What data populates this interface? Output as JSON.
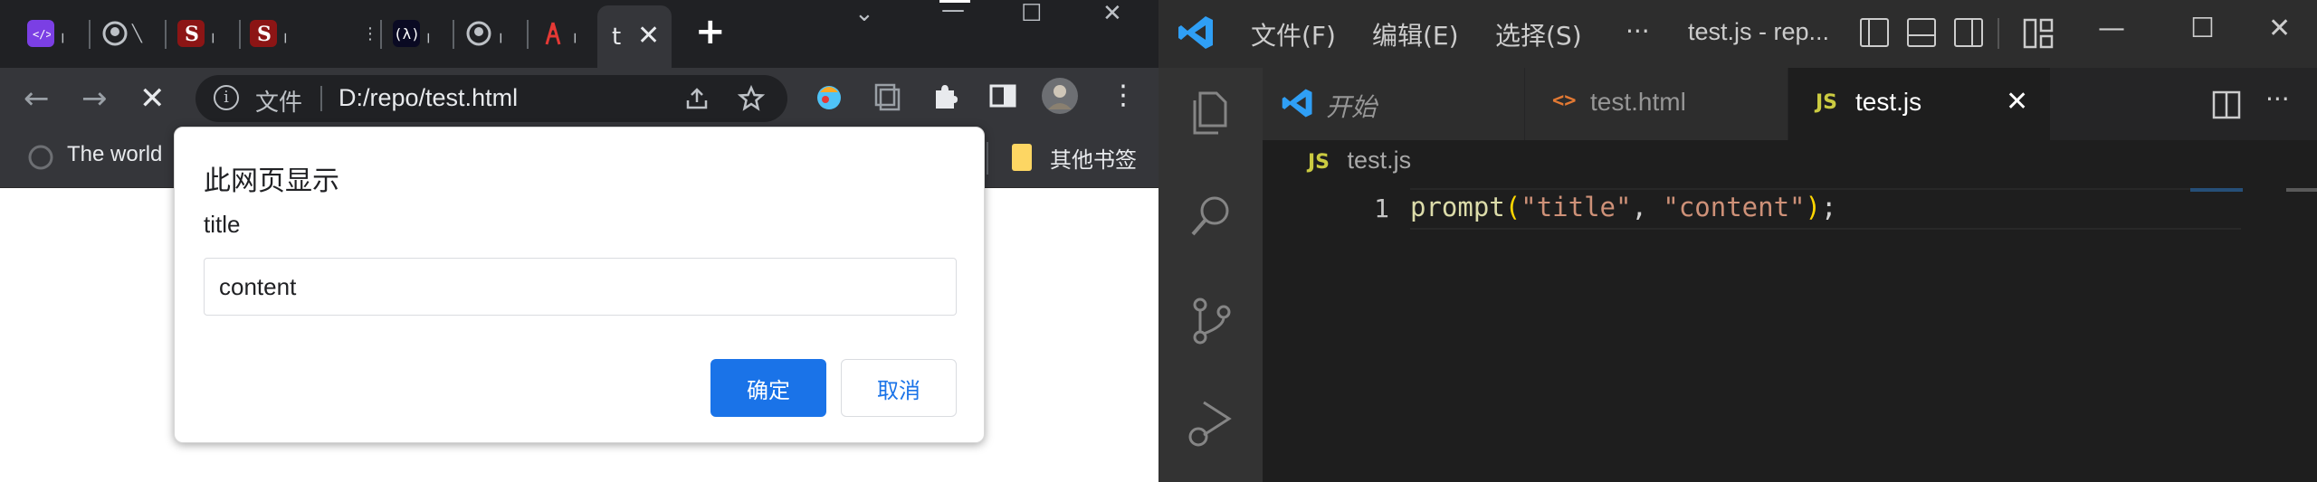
{
  "chrome": {
    "tabs": [
      {
        "name": "devtools-tab",
        "fragment": "╷"
      },
      {
        "name": "github-tab",
        "fragment": "╲"
      },
      {
        "name": "stanford-tab-1",
        "fragment": "╷"
      },
      {
        "name": "stanford-tab-2",
        "fragment": "╷"
      },
      {
        "name": "blank-tab",
        "fragment": "⋮"
      },
      {
        "name": "freecodecamp-tab",
        "fragment": "╷"
      },
      {
        "name": "github-tab-2",
        "fragment": "╷"
      },
      {
        "name": "tower-tab",
        "fragment": "╷"
      }
    ],
    "active_tab": {
      "title": "t",
      "close": "✕"
    },
    "new_tab": "+",
    "window_controls": {
      "chevron": "⌄",
      "minimize": "—",
      "maximize": "☐",
      "close": "✕"
    },
    "omnibox": {
      "scheme_label": "文件",
      "url": "D:/repo/test.html",
      "info": "i"
    },
    "bookmarks": {
      "first": "The world",
      "other": "其他书签"
    }
  },
  "dialog": {
    "title": "此网页显示",
    "message": "title",
    "input_value": "content",
    "ok": "确定",
    "cancel": "取消"
  },
  "vscode": {
    "menus": [
      "文件(F)",
      "编辑(E)",
      "选择(S)",
      "···"
    ],
    "title": "test.js - rep...",
    "window_controls": {
      "minimize": "—",
      "maximize": "☐",
      "close": "✕"
    },
    "tabs": [
      {
        "label": "开始",
        "icon": "vscode-icon"
      },
      {
        "label": "test.html",
        "icon": "html-icon",
        "icon_text": "<>"
      },
      {
        "label": "test.js",
        "icon": "js-icon",
        "icon_text": "JS",
        "close": "✕"
      }
    ],
    "more": "···",
    "breadcrumb": {
      "icon_text": "JS",
      "file": "test.js"
    },
    "editor": {
      "line_number": "1",
      "fn": "prompt",
      "open": "(",
      "arg1": "\"title\"",
      "comma": ", ",
      "arg2": "\"content\"",
      "close": ")",
      "semi": ";"
    }
  },
  "colors": {
    "chrome_dark": "#202124",
    "chrome_toolbar": "#35363a",
    "accent_blue": "#1a73e8",
    "vscode_bg": "#1e1e1e",
    "vscode_activity": "#333333",
    "string": "#ce9178",
    "function": "#dcdcaa",
    "bracket": "#ffd700"
  }
}
